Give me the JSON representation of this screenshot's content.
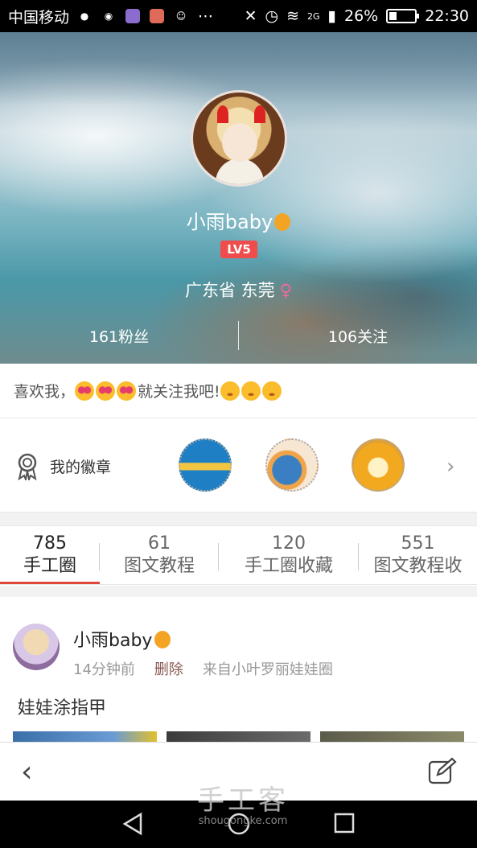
{
  "status_bar": {
    "carrier": "中国移动",
    "network": "2G",
    "battery": "26%",
    "battery_level": 0.26,
    "time": "22:30",
    "icons": [
      "notification-icon",
      "wechat-icon",
      "gallery-icon",
      "app-icon",
      "app-icon-2",
      "more-dots-icon",
      "mute-icon",
      "alarm-icon",
      "wifi-icon",
      "signal-icon",
      "battery-icon"
    ]
  },
  "profile": {
    "nickname": "小雨baby",
    "level": "LV5",
    "location": "广东省 东莞",
    "gender_symbol": "♀",
    "followers": "161粉丝",
    "following": "106关注"
  },
  "bio": {
    "text_prefix": "喜欢我，",
    "text_middle": "就关注我吧!"
  },
  "badges": {
    "title": "我的徽章",
    "chevron": "›"
  },
  "tabs": [
    {
      "count": "785",
      "label": "手工圈",
      "active": true
    },
    {
      "count": "61",
      "label": "图文教程",
      "active": false
    },
    {
      "count": "120",
      "label": "手工圈收藏",
      "active": false
    },
    {
      "count": "551",
      "label": "图文教程收",
      "active": false
    }
  ],
  "post": {
    "author": "小雨baby",
    "time": "14分钟前",
    "delete_label": "删除",
    "source": "来自小叶罗丽娃娃圈",
    "title": "娃娃涂指甲"
  },
  "bottom_bar": {
    "back_icon": "‹"
  },
  "watermark": {
    "line1": "手工客",
    "line2": "shougongke.com"
  },
  "colors": {
    "accent": "#e0473b",
    "level_badge": "#f04c4c",
    "gender": "#f06a9b"
  }
}
